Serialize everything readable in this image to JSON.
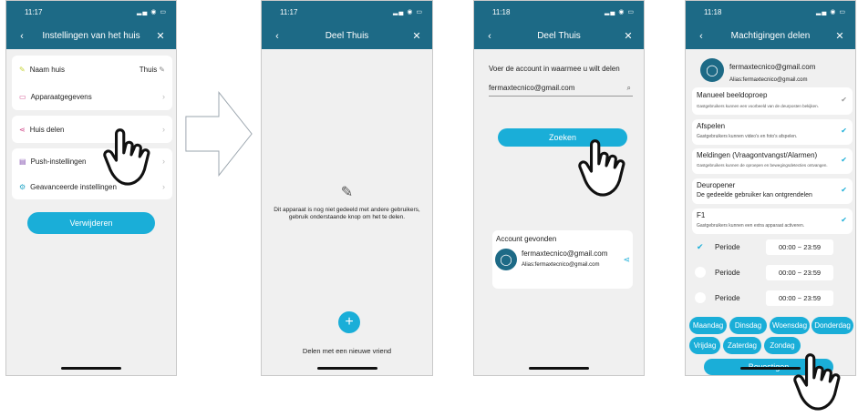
{
  "screen1": {
    "time": "11:17",
    "title": "Instellingen van het huis",
    "rows": {
      "name_label": "Naam huis",
      "name_value": "Thuis",
      "device": "Apparaatgegevens",
      "share": "Huis delen",
      "push": "Push-instellingen",
      "advanced": "Geavanceerde instellingen"
    },
    "delete_label": "Verwijderen"
  },
  "screen2": {
    "time": "11:17",
    "title": "Deel Thuis",
    "empty_text": "Dit apparaat is nog niet gedeeld met andere gebruikers, gebruik onderstaande knop om het te delen.",
    "add_label": "Delen met een nieuwe vriend"
  },
  "screen3": {
    "time": "11:18",
    "title": "Deel Thuis",
    "prompt": "Voer de account in waarmee u wilt delen",
    "search_value": "fermaxtecnico@gmail.com",
    "search_button": "Zoeken",
    "found_title": "Account gevonden",
    "found_email": "fermaxtecnico@gmail.com",
    "found_alias": "Alias:fermaxtecnico@gmail.com"
  },
  "screen4": {
    "time": "11:18",
    "title": "Machtigingen delen",
    "email": "fermaxtecnico@gmail.com",
    "alias": "Alias:fermaxtecnico@gmail.com",
    "perms": [
      {
        "title": "Manueel beeldoproep",
        "desc": "Gastgebruikers kunnen een voorbeeld van de deurposten bekijken."
      },
      {
        "title": "Afspelen",
        "desc": "Gastgebruikers kunnen video's en foto's afspelen."
      },
      {
        "title": "Meldingen (Vraagontvangst/Alarmen)",
        "desc": "Gastgebruikers kunnen de oproepen en bewegingsdetecties ontvangen."
      },
      {
        "title": "Deuropener",
        "desc": "De gedeelde gebruiker kan ontgrendelen"
      },
      {
        "title": "F1",
        "desc": "Gastgebruikers kunnen een extra apparaat activeren."
      }
    ],
    "periods": [
      {
        "label": "Periode",
        "time": "00:00 ~ 23:59"
      },
      {
        "label": "Periode",
        "time": "00:00 ~ 23:59"
      },
      {
        "label": "Periode",
        "time": "00:00 ~ 23:59"
      }
    ],
    "days": [
      "Maandag",
      "Dinsdag",
      "Woensdag",
      "Donderdag",
      "Vrijdag",
      "Zaterdag",
      "Zondag"
    ],
    "confirm": "Bevestigen"
  },
  "colors": {
    "header": "#1d6a86",
    "accent": "#1aaed8"
  }
}
